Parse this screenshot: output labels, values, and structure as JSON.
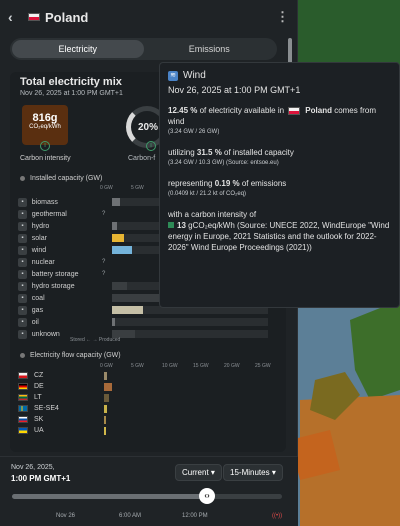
{
  "header": {
    "country": "Poland"
  },
  "tabs": [
    {
      "label": "Electricity"
    },
    {
      "label": "Emissions"
    }
  ],
  "mix": {
    "title": "Total electricity mix",
    "datetime": "Nov 26, 2025 at 1:00 PM GMT+1",
    "carbon_value": "816g",
    "carbon_unit": "CO₂eq/kWh",
    "carbon_label": "Carbon intensity",
    "ring_value": "20%",
    "ring_label": "Carbon-f"
  },
  "capacity": {
    "title": "Installed capacity (GW)",
    "axis": [
      "0 GW",
      "5 GW",
      "10 GW",
      "15 GW",
      "20 GW",
      "25 GW"
    ],
    "rows": [
      {
        "icon": "biomass-icon",
        "label": "biomass",
        "q": "",
        "fill": 0.05,
        "color": "#6e7174"
      },
      {
        "icon": "geothermal-icon",
        "label": "geothermal",
        "q": "?",
        "fill": 0,
        "color": "#6e7174"
      },
      {
        "icon": "hydro-icon",
        "label": "hydro",
        "q": "",
        "fill": 0.03,
        "color": "#6e7174"
      },
      {
        "icon": "solar-icon",
        "label": "solar",
        "q": "",
        "fill": 0.08,
        "color": "#e7b533"
      },
      {
        "icon": "wind-icon",
        "label": "wind",
        "q": "",
        "fill": 0.13,
        "color": "#74b3da"
      },
      {
        "icon": "nuclear-icon",
        "label": "nuclear",
        "q": "?",
        "fill": 0,
        "color": "#6e7174"
      },
      {
        "icon": "battery-icon",
        "label": "battery storage",
        "q": "?",
        "fill": 0,
        "color": "#6e7174"
      },
      {
        "icon": "hydro-storage-icon",
        "label": "hydro storage",
        "q": "",
        "fill": 0.1,
        "color": "#3a3e41"
      },
      {
        "icon": "coal-icon",
        "label": "coal",
        "q": "",
        "fill": 1,
        "color": "#3a3e41"
      },
      {
        "icon": "gas-icon",
        "label": "gas",
        "q": "",
        "fill": 0.2,
        "color": "#c5bfa6"
      },
      {
        "icon": "oil-icon",
        "label": "oil",
        "q": "",
        "fill": 0.02,
        "color": "#6e7174"
      },
      {
        "icon": "unknown-icon",
        "label": "unknown",
        "q": "",
        "fill": 0.15,
        "color": "#3a3e41"
      }
    ],
    "legend": "Stored ←  → Produced"
  },
  "flow": {
    "title": "Electricity flow capacity (GW)",
    "axis": [
      "0 GW",
      "5 GW",
      "10 GW",
      "15 GW",
      "20 GW",
      "25 GW"
    ],
    "rows": [
      {
        "label": "CZ",
        "flag": "linear-gradient(#f2f2f2 50%,#d7141a 50%)",
        "fill": 0.02,
        "color": "#9a8a6a"
      },
      {
        "label": "DE",
        "flag": "linear-gradient(#000 33%,#dd0000 33%,#dd0000 66%,#ffce00 66%)",
        "fill": 0.05,
        "color": "#a86a3a"
      },
      {
        "label": "LT",
        "flag": "linear-gradient(#fdb913 33%,#006a44 33%,#006a44 66%,#c1272d 66%)",
        "fill": 0.03,
        "color": "#6a5a3a"
      },
      {
        "label": "SE-SE4",
        "flag": "linear-gradient(90deg,#006aa7 30%,#fecc00 30%,#fecc00 45%,#006aa7 45%)",
        "fill": 0.02,
        "color": "#c9b34a"
      },
      {
        "label": "SK",
        "flag": "linear-gradient(#fff 33%,#0b4ea2 33%,#0b4ea2 66%,#ee1c25 66%)",
        "fill": 0.01,
        "color": "#a88a4a"
      },
      {
        "label": "UA",
        "flag": "linear-gradient(#0057b7 50%,#ffd700 50%)",
        "fill": 0.01,
        "color": "#d0b84a"
      }
    ]
  },
  "timeline": {
    "date": "Nov 26, 2025,",
    "time": "1:00 PM GMT+1",
    "current": "Current",
    "interval": "15-Minutes",
    "ticks": [
      "Nov 26",
      "6:00 AM",
      "12:00 PM"
    ],
    "progress": 0.73
  },
  "tooltip": {
    "title": "Wind",
    "datetime": "Nov 26, 2025 at 1:00 PM GMT+1",
    "p1_pct": "12.45 %",
    "p1_text": " of electricity available in ",
    "p1_country": "Poland",
    "p1_end": " comes from wind",
    "p1_sub": "(3.24 GW / 26 GW)",
    "p2_pre": "utilizing ",
    "p2_pct": "31.5 %",
    "p2_end": " of installed capacity",
    "p2_sub": "(3.24 GW / 10.3 GW) (Source: entsoe.eu)",
    "p3_pre": "representing ",
    "p3_pct": "0.19 %",
    "p3_end": " of emissions",
    "p3_sub": "(0.0409 kt / 21.2 kt of CO₂eq)",
    "p4_pre": "with a carbon intensity of",
    "p4_val": "13",
    "p4_unit": " gCO₂eq/kWh",
    "p4_src": " (Source: UNECE 2022, WindEurope \"Wind energy in Europe, 2021 Statistics and the outlook for 2022-2026\" Wind Europe Proceedings (2021))"
  }
}
